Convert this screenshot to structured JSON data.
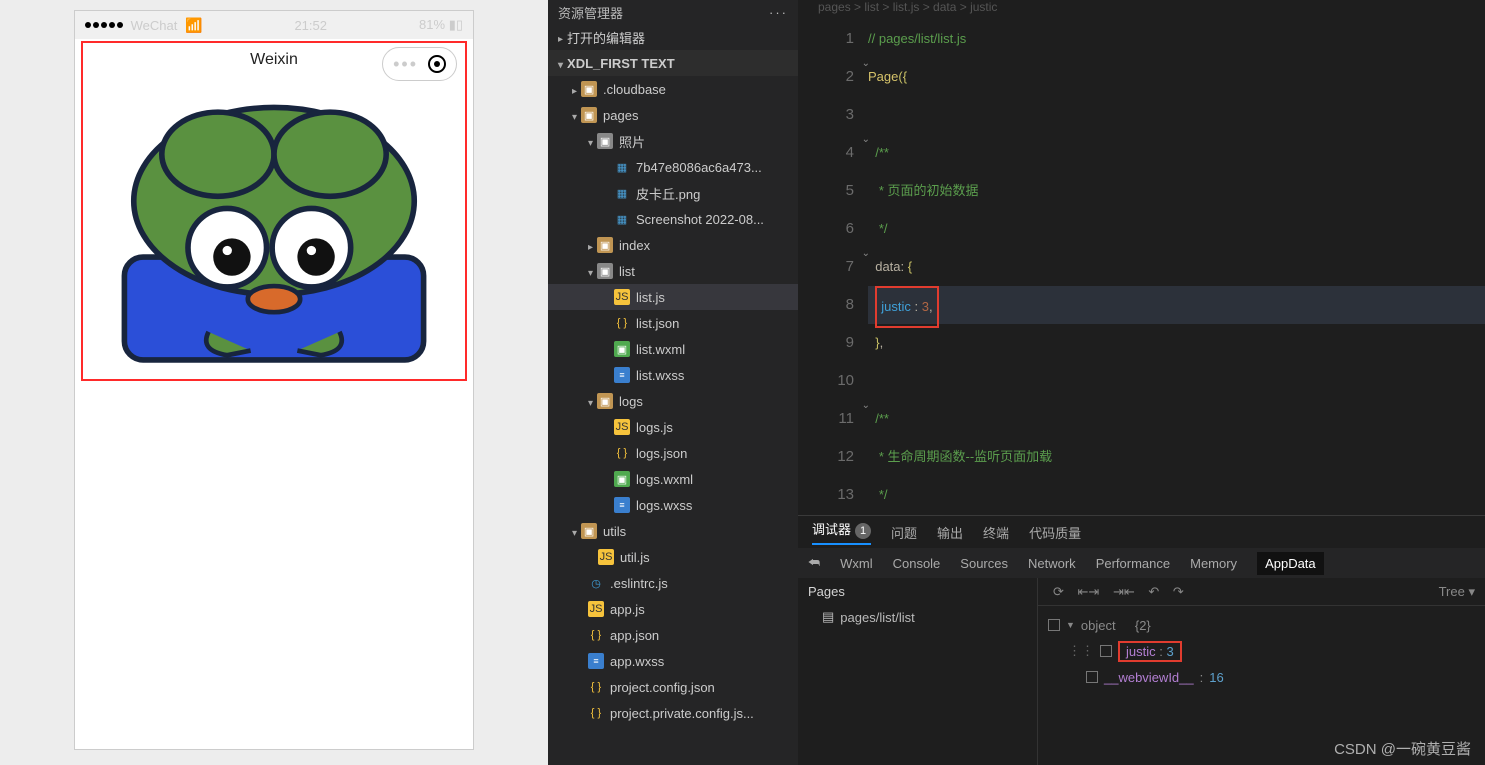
{
  "sim": {
    "carrier": "WeChat",
    "time": "21:52",
    "battery": "81%",
    "title": "Weixin"
  },
  "explorer": {
    "title": "资源管理器",
    "sections": {
      "open_editors": "打开的编辑器",
      "project": "XDL_FIRST TEXT"
    },
    "items": {
      "cloudbase": ".cloudbase",
      "pages": "pages",
      "photos": "照片",
      "f1": "7b47e8086ac6a473...",
      "f2": "皮卡丘.png",
      "f3": "Screenshot 2022-08...",
      "index": "index",
      "list": "list",
      "listjs": "list.js",
      "listjson": "list.json",
      "listwxml": "list.wxml",
      "listwxss": "list.wxss",
      "logs": "logs",
      "logsjs": "logs.js",
      "logsjson": "logs.json",
      "logswxml": "logs.wxml",
      "logswxss": "logs.wxss",
      "utils": "utils",
      "utiljs": "util.js",
      "eslint": ".eslintrc.js",
      "appjs": "app.js",
      "appjson": "app.json",
      "appwxss": "app.wxss",
      "pcfg": "project.config.json",
      "ppc": "project.private.config.js..."
    }
  },
  "code": {
    "l1": "// pages/list/list.js",
    "l2a": "Page",
    "l2b": "({",
    "l4a": "  /**",
    "l5a": "   * 页面的初始数据",
    "l6a": "   */",
    "l7a": "  data",
    "l7b": ": ",
    "l7c": "{",
    "l8a": "justic ",
    "l8b": ": ",
    "l8c": "3",
    "l8d": ",",
    "l9a": "  }",
    "l9b": ",",
    "l11a": "  /**",
    "l12a": "   * 生命周期函数--监听页面加载",
    "l13a": "   */",
    "lines": [
      "1",
      "2",
      "3",
      "4",
      "5",
      "6",
      "7",
      "8",
      "9",
      "10",
      "11",
      "12",
      "13"
    ]
  },
  "debugger": {
    "tabs": {
      "debug": "调试器",
      "issue": "问题",
      "output": "输出",
      "term": "终端",
      "quality": "代码质量"
    },
    "badge": "1",
    "devtabs": {
      "wxml": "Wxml",
      "console": "Console",
      "sources": "Sources",
      "network": "Network",
      "perf": "Performance",
      "mem": "Memory",
      "appdata": "AppData"
    },
    "pages": {
      "title": "Pages",
      "item": "pages/list/list"
    },
    "tree": {
      "mode": "Tree",
      "root": "object",
      "count": "{2}",
      "k1": "justic",
      "v1": "3",
      "k2": "__webviewId__",
      "v2": "16"
    }
  },
  "watermark": "CSDN @一碗黄豆酱"
}
